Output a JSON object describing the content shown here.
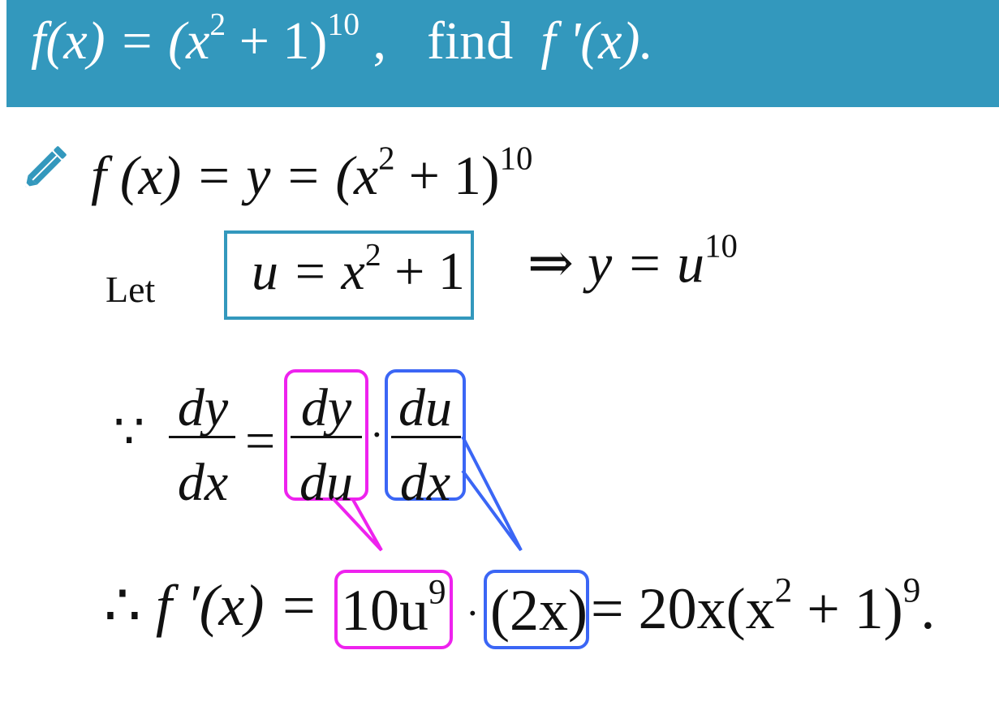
{
  "banner": {
    "problem_lhs": "f(x) = (x",
    "problem_exp1": "2",
    "problem_mid": " + 1)",
    "problem_exp2": "10",
    "problem_comma": " ,",
    "find_word": "find",
    "find_target": "f '(x).",
    "background_color": "#3398bd"
  },
  "step1": {
    "lhs": "f (x) = y = (x",
    "exp1": "2",
    "mid": " + 1)",
    "exp2": "10"
  },
  "step2": {
    "let_label": "Let",
    "boxed_lhs": "u = x",
    "boxed_exp": "2",
    "boxed_rhs": " + 1",
    "implies_symbol": "⇒",
    "implies_lhs": "y = u",
    "implies_exp": "10"
  },
  "step3": {
    "because_symbol": "∵",
    "frac1_num": "dy",
    "frac1_den": "dx",
    "equals": "=",
    "frac2_num": "dy",
    "frac2_den": "du",
    "dot": "·",
    "frac3_num": "du",
    "frac3_den": "dx"
  },
  "step4": {
    "therefore_symbol": "∴",
    "lhs": "f ′(x) =",
    "box1_base": "10u",
    "box1_exp": "9",
    "dot": "·",
    "box2": "(2x)",
    "rhs": "= 20x(x",
    "rhs_exp1": "2",
    "rhs_mid": " + 1)",
    "rhs_exp2": "9",
    "rhs_end": "."
  },
  "colors": {
    "magenta_highlight": "#ee22ee",
    "blue_highlight": "#3b66f5",
    "teal_box": "#3398bd"
  },
  "icons": [
    "pencil-icon"
  ]
}
